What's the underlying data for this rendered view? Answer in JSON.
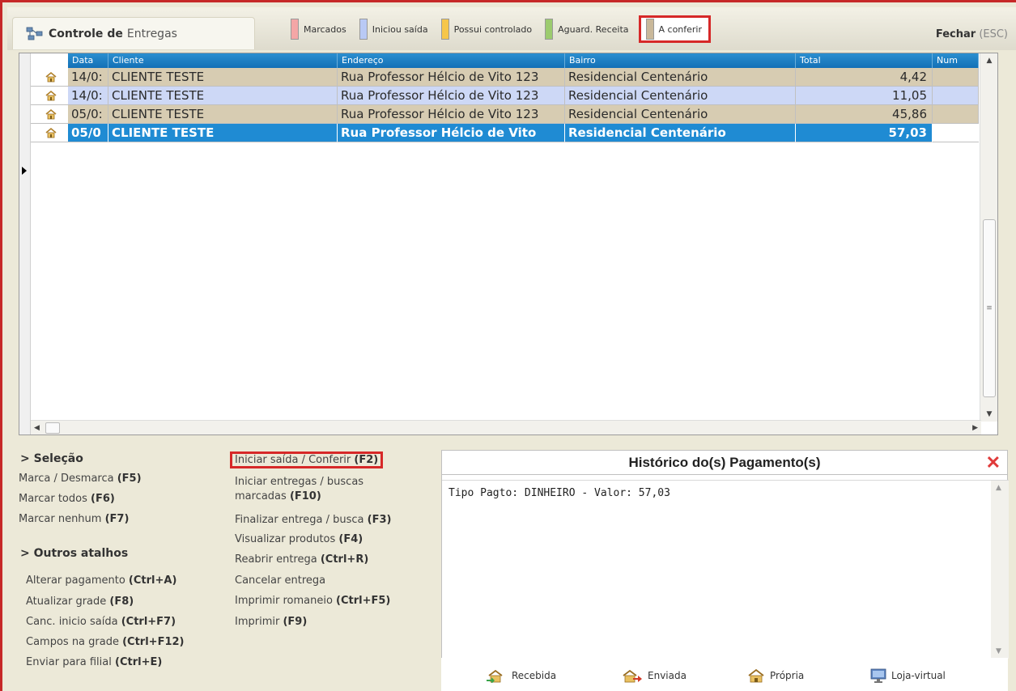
{
  "window": {
    "title_prefix": "Controle",
    "title_mid": "de",
    "title_suffix": "Entregas",
    "close_label": "Fechar",
    "close_key": "(ESC)"
  },
  "legend": [
    {
      "label": "Marcados",
      "color": "#f4a6a6"
    },
    {
      "label": "Iniciou saída",
      "color": "#b9c9f5"
    },
    {
      "label": "Possui controlado",
      "color": "#f6c64a"
    },
    {
      "label": "Aguard. Receita",
      "color": "#9ccb6e"
    },
    {
      "label": "A conferir",
      "color": "#c9b89a"
    }
  ],
  "grid": {
    "columns": [
      "Data",
      "Cliente",
      "Endereço",
      "Bairro",
      "Total",
      "Num"
    ],
    "rows": [
      {
        "data": "14/0:",
        "cliente": "CLIENTE TESTE",
        "endereco": "Rua Professor Hélcio de Vito 123",
        "bairro": "Residencial Centenário",
        "total": "4,42"
      },
      {
        "data": "14/0:",
        "cliente": "CLIENTE TESTE",
        "endereco": "Rua Professor Hélcio de Vito 123",
        "bairro": "Residencial Centenário",
        "total": "11,05"
      },
      {
        "data": "05/0:",
        "cliente": "CLIENTE TESTE",
        "endereco": "Rua Professor Hélcio de Vito 123",
        "bairro": "Residencial Centenário",
        "total": "45,86"
      },
      {
        "data": "05/0",
        "cliente": "CLIENTE TESTE",
        "endereco": "Rua Professor Hélcio de Vito",
        "bairro": "Residencial Centenário",
        "total": "57,03"
      }
    ]
  },
  "shortcuts": {
    "selecao_heading": "> Seleção",
    "marca_desmarca": "Marca / Desmarca",
    "marca_desmarca_key": "(F5)",
    "marcar_todos": "Marcar todos",
    "marcar_todos_key": "(F6)",
    "marcar_nenhum": "Marcar nenhum",
    "marcar_nenhum_key": "(F7)",
    "outros_heading": "> Outros atalhos",
    "alterar_pagamento": "Alterar pagamento",
    "alterar_pagamento_key": "(Ctrl+A)",
    "atualizar_grade": "Atualizar grade",
    "atualizar_grade_key": "(F8)",
    "canc_inicio": "Canc. inicio saída",
    "canc_inicio_key": "(Ctrl+F7)",
    "campos_grade": "Campos na grade",
    "campos_grade_key": "(Ctrl+F12)",
    "enviar_filial": "Enviar para filial",
    "enviar_filial_key": "(Ctrl+E)",
    "iniciar_saida": "Iniciar saída / Conferir",
    "iniciar_saida_key": "(F2)",
    "iniciar_entregas_1": "Iniciar entregas / buscas",
    "iniciar_entregas_2": "marcadas",
    "iniciar_entregas_key": "(F10)",
    "finalizar": "Finalizar entrega / busca",
    "finalizar_key": "(F3)",
    "visualizar": "Visualizar produtos",
    "visualizar_key": "(F4)",
    "reabrir": "Reabrir entrega",
    "reabrir_key": "(Ctrl+R)",
    "cancelar": "Cancelar entrega",
    "imprimir_romaneio": "Imprimir romaneio",
    "imprimir_romaneio_key": "(Ctrl+F5)",
    "imprimir": "Imprimir",
    "imprimir_key": "(F9)"
  },
  "payment": {
    "title": "Histórico do(s) Pagamento(s)",
    "text": "Tipo Pagto: DINHEIRO - Valor: 57,03"
  },
  "origins": {
    "recebida": "Recebida",
    "enviada": "Enviada",
    "propria": "Própria",
    "loja_virtual": "Loja-virtual"
  },
  "colors": {
    "highlight_border": "#d62828",
    "header_blue": "#1f8bd3",
    "row_tan": "#d7ccb2",
    "row_blue": "#cdd8f6"
  }
}
